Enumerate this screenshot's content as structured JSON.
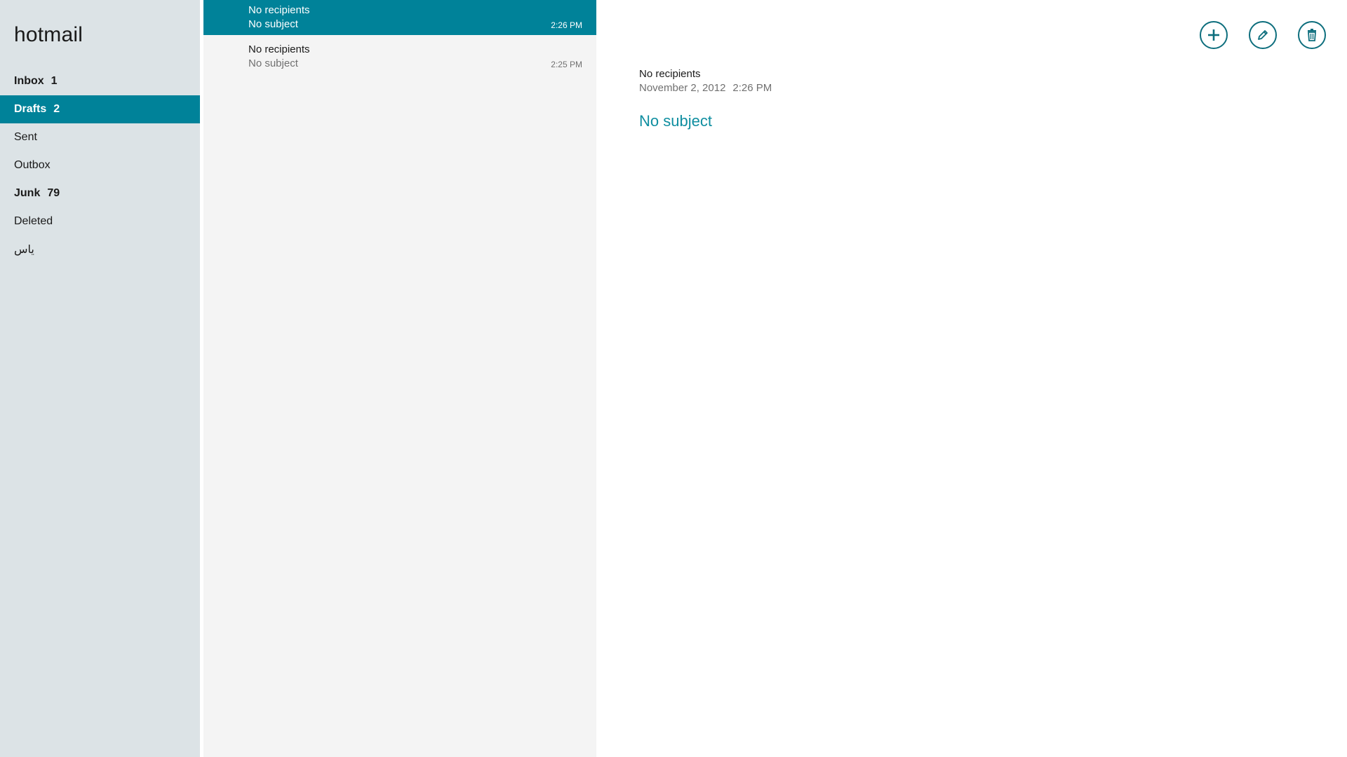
{
  "account": {
    "title": "hotmail"
  },
  "folders": [
    {
      "label": "Inbox",
      "count": "1",
      "bold": true,
      "selected": false
    },
    {
      "label": "Drafts",
      "count": "2",
      "bold": true,
      "selected": true
    },
    {
      "label": "Sent",
      "count": "",
      "bold": false,
      "selected": false
    },
    {
      "label": "Outbox",
      "count": "",
      "bold": false,
      "selected": false
    },
    {
      "label": "Junk",
      "count": "79",
      "bold": true,
      "selected": false
    },
    {
      "label": "Deleted",
      "count": "",
      "bold": false,
      "selected": false
    },
    {
      "label": "ياس",
      "count": "",
      "bold": false,
      "selected": false
    }
  ],
  "messages": [
    {
      "sender": "No recipients",
      "subject": "No subject",
      "time": "2:26 PM",
      "selected": true
    },
    {
      "sender": "No recipients",
      "subject": "No subject",
      "time": "2:25 PM",
      "selected": false
    }
  ],
  "reading_pane": {
    "recipients": "No recipients",
    "date": "November 2, 2012",
    "time": "2:26 PM",
    "subject": "No subject"
  },
  "toolbar": {
    "new_icon": "plus-icon",
    "edit_icon": "pencil-icon",
    "delete_icon": "trash-icon"
  },
  "colors": {
    "accent": "#008299",
    "sidebar_bg": "#dce3e6",
    "list_bg": "#f4f4f4",
    "subject_link": "#0f8ea0"
  }
}
